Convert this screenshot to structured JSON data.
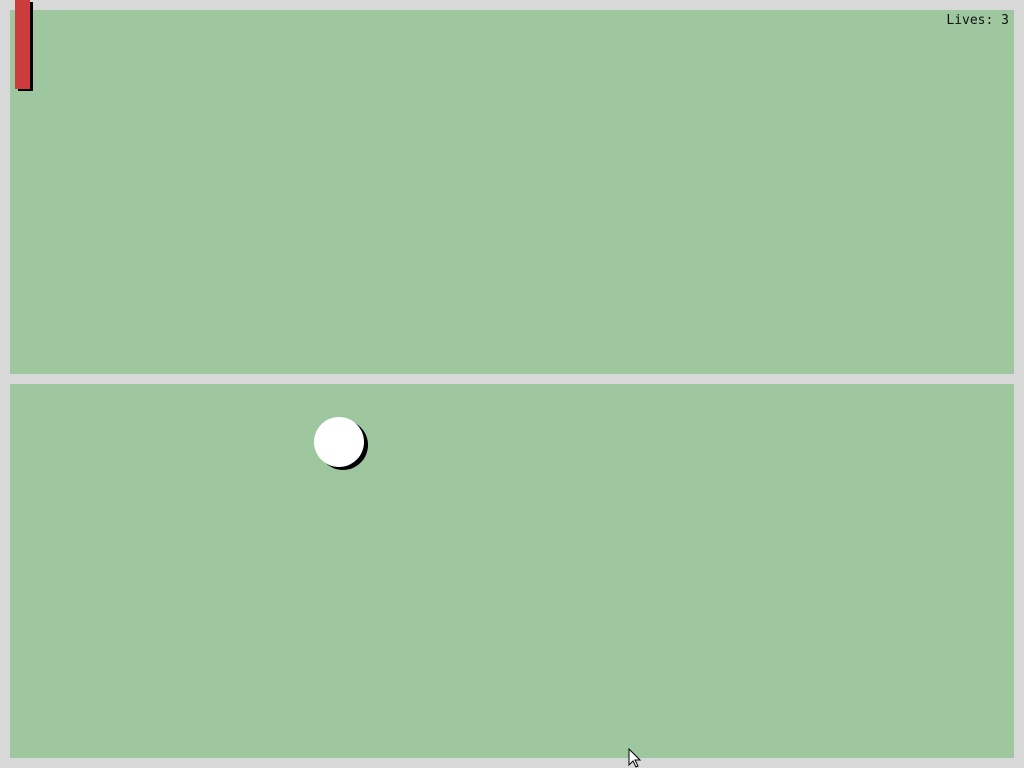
{
  "hud": {
    "lives_text": "Lives: 3"
  },
  "colors": {
    "background": "#d8d8d8",
    "court": "#9fc79f",
    "paddle": "#cc3c3c",
    "ball": "#ffffff",
    "shadow": "#000000"
  },
  "icons": {
    "cursor": "mouse-pointer-icon"
  }
}
